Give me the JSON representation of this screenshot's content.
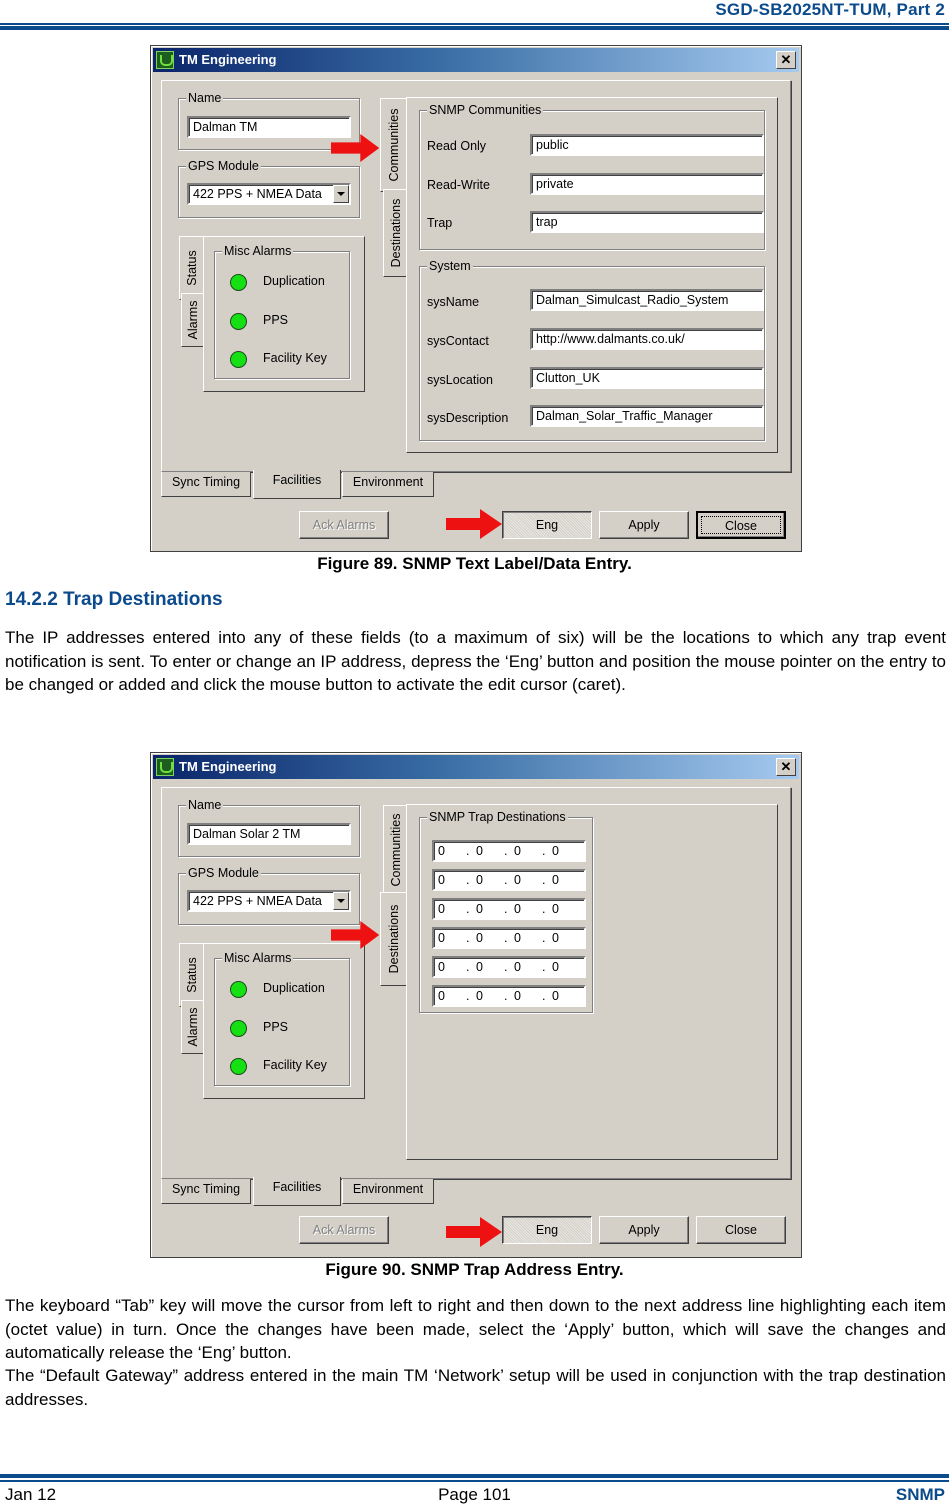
{
  "header": {
    "doc_title": "SGD-SB2025NT-TUM, Part 2"
  },
  "dialog1": {
    "window_title": "TM Engineering",
    "name_group": {
      "title": "Name",
      "value": "Dalman TM"
    },
    "gps_group": {
      "title": "GPS Module",
      "selected": "422 PPS + NMEA Data"
    },
    "left_tabs": [
      "Status",
      "Alarms"
    ],
    "misc_alarms": {
      "title": "Misc Alarms",
      "items": [
        {
          "label": "Duplication",
          "color": "#14e014"
        },
        {
          "label": "PPS",
          "color": "#14e014"
        },
        {
          "label": "Facility Key",
          "color": "#14e014"
        }
      ]
    },
    "right_tabs": [
      "Communities",
      "Destinations"
    ],
    "active_right_tab": "Communities",
    "communities": {
      "title": "SNMP Communities",
      "fields": [
        {
          "label": "Read Only",
          "value": "public"
        },
        {
          "label": "Read-Write",
          "value": "private"
        },
        {
          "label": "Trap",
          "value": "trap"
        }
      ]
    },
    "system": {
      "title": "System",
      "fields": [
        {
          "label": "sysName",
          "value": "Dalman_Simulcast_Radio_System"
        },
        {
          "label": "sysContact",
          "value": "http://www.dalmants.co.uk/"
        },
        {
          "label": "sysLocation",
          "value": "Clutton_UK"
        },
        {
          "label": "sysDescription",
          "value": "Dalman_Solar_Traffic_Manager"
        }
      ]
    },
    "bottom_tabs": [
      "Sync Timing",
      "Facilities",
      "Environment"
    ],
    "active_bottom_tab": "Facilities",
    "buttons": {
      "ack": "Ack Alarms",
      "eng": "Eng",
      "apply": "Apply",
      "close": "Close"
    }
  },
  "figure1_caption": "Figure 89.  SNMP Text Label/Data Entry.",
  "section": {
    "heading": "14.2.2   Trap Destinations",
    "para1": "The IP addresses entered into any of these fields (to a maximum of six) will be the locations to which any trap event notification is sent.  To enter or change an IP address, depress the ‘Eng’ button and position the mouse pointer on the entry to be changed or added and click the mouse button to activate the edit cursor (caret)."
  },
  "dialog2": {
    "window_title": "TM Engineering",
    "name_group": {
      "title": "Name",
      "value": "Dalman Solar 2 TM"
    },
    "gps_group": {
      "title": "GPS Module",
      "selected": "422 PPS + NMEA Data"
    },
    "left_tabs": [
      "Status",
      "Alarms"
    ],
    "misc_alarms": {
      "title": "Misc Alarms",
      "items": [
        {
          "label": "Duplication",
          "color": "#14e014"
        },
        {
          "label": "PPS",
          "color": "#14e014"
        },
        {
          "label": "Facility Key",
          "color": "#14e014"
        }
      ]
    },
    "right_tabs": [
      "Communities",
      "Destinations"
    ],
    "active_right_tab": "Destinations",
    "trap_destinations": {
      "title": "SNMP Trap Destinations",
      "addresses": [
        [
          "0",
          "0",
          "0",
          "0"
        ],
        [
          "0",
          "0",
          "0",
          "0"
        ],
        [
          "0",
          "0",
          "0",
          "0"
        ],
        [
          "0",
          "0",
          "0",
          "0"
        ],
        [
          "0",
          "0",
          "0",
          "0"
        ],
        [
          "0",
          "0",
          "0",
          "0"
        ]
      ]
    },
    "bottom_tabs": [
      "Sync Timing",
      "Facilities",
      "Environment"
    ],
    "active_bottom_tab": "Facilities",
    "buttons": {
      "ack": "Ack Alarms",
      "eng": "Eng",
      "apply": "Apply",
      "close": "Close"
    }
  },
  "figure2_caption": "Figure 90.  SNMP Trap Address Entry.",
  "para2": "The keyboard “Tab” key will move the cursor from left to right and then down to the next address line highlighting each item (octet value) in turn.  Once the changes have been made, select the ‘Apply’ button, which will save the changes and automatically release the ‘Eng’ button.",
  "para3": "The “Default Gateway” address entered in the main TM ‘Network’ setup will be used in conjunction with the trap destination addresses.",
  "footer": {
    "date": "Jan 12",
    "page": "Page 101",
    "section": "SNMP"
  },
  "colors": {
    "brand_blue": "#0b4a8b",
    "arrow_red": "#ee1111",
    "led_green": "#14e014"
  }
}
